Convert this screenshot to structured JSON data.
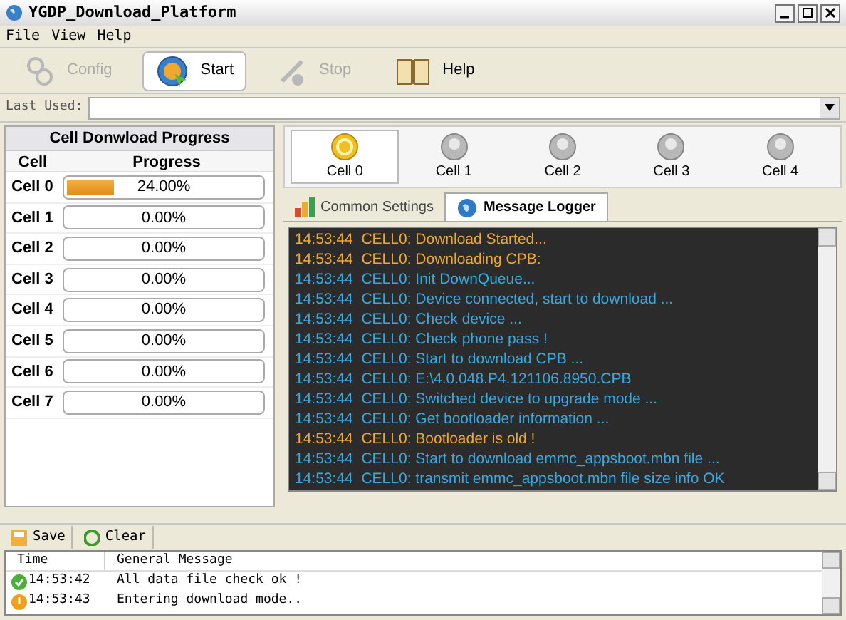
{
  "window": {
    "title": "YGDP_Download_Platform"
  },
  "menu": [
    "File",
    "View",
    "Help"
  ],
  "toolbar": [
    {
      "label": "Config",
      "kind": "config",
      "disabled": true,
      "selected": false
    },
    {
      "label": "Start",
      "kind": "start",
      "disabled": false,
      "selected": true
    },
    {
      "label": "Stop",
      "kind": "stop",
      "disabled": true,
      "selected": false
    },
    {
      "label": "Help",
      "kind": "help",
      "disabled": false,
      "selected": false
    }
  ],
  "last_used": {
    "label": "Last Used:"
  },
  "progress_panel": {
    "title": "Cell Donwload Progress",
    "columns": [
      "Cell",
      "Progress"
    ],
    "rows": [
      {
        "cell": "Cell 0",
        "level": 0.24,
        "reading": "24.00%"
      },
      {
        "cell": "Cell 1",
        "level": 0,
        "reading": "0.00%"
      },
      {
        "cell": "Cell 2",
        "level": 0,
        "reading": "0.00%"
      },
      {
        "cell": "Cell 3",
        "level": 0,
        "reading": "0.00%"
      },
      {
        "cell": "Cell 4",
        "level": 0,
        "reading": "0.00%"
      },
      {
        "cell": "Cell 5",
        "level": 0,
        "reading": "0.00%"
      },
      {
        "cell": "Cell 6",
        "level": 0,
        "reading": "0.00%"
      },
      {
        "cell": "Cell 7",
        "level": 0,
        "reading": "0.00%"
      }
    ]
  },
  "cells": [
    {
      "label": "Cell 0",
      "selected": true,
      "active": true
    },
    {
      "label": "Cell 1",
      "selected": false,
      "active": false
    },
    {
      "label": "Cell 2",
      "selected": false,
      "active": false
    },
    {
      "label": "Cell 3",
      "selected": false,
      "active": false
    },
    {
      "label": "Cell 4",
      "selected": false,
      "active": false
    }
  ],
  "tabs": [
    {
      "label": "Common Settings",
      "kind": "chart",
      "selected": false
    },
    {
      "label": "Message Logger",
      "kind": "globe",
      "selected": true
    }
  ],
  "log": [
    {
      "time": "14:53:44",
      "text": "CELL0: Download Started...",
      "color": "#f0a830"
    },
    {
      "time": "14:53:44",
      "text": "CELL0: Downloading CPB:",
      "color": "#f0a830"
    },
    {
      "time": "14:53:44",
      "text": "CELL0: Init DownQueue...",
      "color": "#3aa8e0"
    },
    {
      "time": "14:53:44",
      "text": "CELL0: Device connected, start to download ...",
      "color": "#3aa8e0"
    },
    {
      "time": "14:53:44",
      "text": "CELL0: Check device ...",
      "color": "#3aa8e0"
    },
    {
      "time": "14:53:44",
      "text": "CELL0: Check phone pass !",
      "color": "#3aa8e0"
    },
    {
      "time": "14:53:44",
      "text": "CELL0: Start to download CPB ...",
      "color": "#3aa8e0"
    },
    {
      "time": "14:53:44",
      "text": "CELL0: E:\\4.0.048.P4.121106.8950.CPB",
      "color": "#3aa8e0"
    },
    {
      "time": "14:53:44",
      "text": "CELL0: Switched device to upgrade mode ...",
      "color": "#3aa8e0"
    },
    {
      "time": "14:53:44",
      "text": "CELL0: Get bootloader information ...",
      "color": "#3aa8e0"
    },
    {
      "time": "14:53:44",
      "text": "CELL0: Bootloader is old !",
      "color": "#f0a830"
    },
    {
      "time": "14:53:44",
      "text": "CELL0:  Start to download emmc_appsboot.mbn file ...",
      "color": "#3aa8e0"
    },
    {
      "time": "14:53:44",
      "text": "CELL0: transmit emmc_appsboot.mbn file size info OK",
      "color": "#3aa8e0"
    }
  ],
  "bottom_toolbar": [
    "Save",
    "Clear"
  ],
  "messages": {
    "columns": [
      "Time",
      "General Message"
    ],
    "rows": [
      {
        "kind": "ok",
        "time": "14:53:42",
        "message": "All data file check ok !"
      },
      {
        "kind": "warn",
        "time": "14:53:43",
        "message": "Entering download mode.."
      }
    ]
  }
}
